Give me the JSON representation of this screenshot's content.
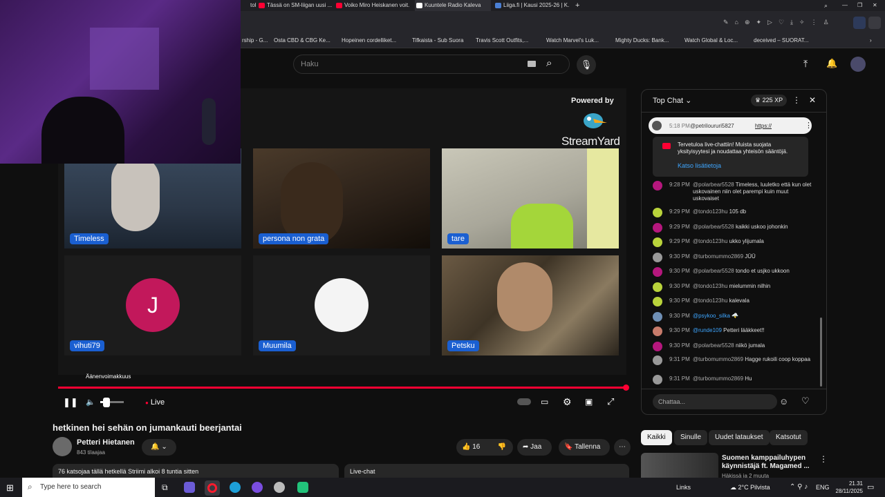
{
  "browser": {
    "tabs": [
      {
        "label": "Tässä on SM-liigan uusi ..."
      },
      {
        "label": "Voiko Miro Heiskanen voit..."
      },
      {
        "label": "Kuuntele Radio Kaleva"
      },
      {
        "label": "Liiga.fi | Kausi 2025-26 | K..."
      }
    ],
    "bookmarks": [
      "rship - G...",
      "Osta CBD & CBG Ke...",
      "Hopeinen cordelliket...",
      "Tifkaista - Sub Suora",
      "Travis Scott Outfits,...",
      "Watch Marvel's Luk...",
      "Mighty Ducks: Bank...",
      "Watch Global & Loc...",
      "deceived – SUORAT..."
    ]
  },
  "youtube": {
    "search_placeholder": "Haku",
    "powered_by": "Powered by",
    "brand": "StreamYard",
    "participants": [
      {
        "name": "Timeless"
      },
      {
        "name": "persona non grata"
      },
      {
        "name": "tare"
      },
      {
        "name": "vihuti79",
        "initial": "J"
      },
      {
        "name": "Muumila"
      },
      {
        "name": "Petsku"
      }
    ],
    "volume_tooltip": "Äänenvoimakkuus",
    "live_label": "Live",
    "video_title": "hetkinen hei sehän on jumankauti beerjantai",
    "channel": {
      "name": "Petteri Hietanen",
      "subs": "843 tilaajaa"
    },
    "likes": "16",
    "share_label": "Jaa",
    "save_label": "Tallenna",
    "viewers_text": "76 katsojaa tällä hetkellä  Striimi alkoi 8 tuntia sitten",
    "livechat_label": "Live-chat",
    "chips": [
      "Kaikki",
      "Sinulle",
      "Uudet lataukset",
      "Katsotut"
    ],
    "recommended": {
      "title": "Suomen kamppailuhypen käynnistäjä ft. Magamed ...",
      "sub": "Häkissä ja 2 muuta"
    }
  },
  "chat": {
    "header": "Top Chat",
    "xp": "225 XP",
    "pinned_author": "@petriloururi5827",
    "pinned_time": "5:18 PM",
    "pinned_text": "https://",
    "welcome": "Tervetuloa live-chattiin! Muista suojata yksityisyytesi ja noudattaa yhteisön sääntöjä.",
    "learn_more": "Katso lisätietoja",
    "input_placeholder": "Chattaa...",
    "messages": [
      {
        "time": "9:28 PM",
        "author": "@polarbear5528",
        "text": "Timeless, luuletko että kun olet uskovainen niin olet parempi kuin muut uskovaiset",
        "color": "#b5177d"
      },
      {
        "time": "9:29 PM",
        "author": "@tondo123hu",
        "text": "105 db",
        "color": "#b9d33b"
      },
      {
        "time": "9:29 PM",
        "author": "@polarbear5528",
        "text": "kaikki uskoo johonkin",
        "color": "#b5177d"
      },
      {
        "time": "9:29 PM",
        "author": "@tondo123hu",
        "text": "ukko ylijumala",
        "color": "#b9d33b"
      },
      {
        "time": "9:30 PM",
        "author": "@turbomummo2869",
        "text": "JÜÜ",
        "color": "#999999"
      },
      {
        "time": "9:30 PM",
        "author": "@polarbear5528",
        "text": "tondo et usjko ukkoon",
        "color": "#b5177d"
      },
      {
        "time": "9:30 PM",
        "author": "@tondo123hu",
        "text": "mielummin nilhin",
        "color": "#b9d33b"
      },
      {
        "time": "9:30 PM",
        "author": "@tondo123hu",
        "text": "kalevala",
        "color": "#b9d33b"
      },
      {
        "time": "9:30 PM",
        "author": "@psykoo_silka",
        "text": "🌩️",
        "color": "#6f8fb5"
      },
      {
        "time": "9:30 PM",
        "author": "@runde109",
        "text": "Petteri lääkkeet!!",
        "color": "#c77b6b"
      },
      {
        "time": "9:30 PM",
        "author": "@polarbear5528",
        "text": "niikö jumala",
        "color": "#b5177d"
      },
      {
        "time": "9:31 PM",
        "author": "@turbomummo2869",
        "text": "Hagge rukoili coop koppaa",
        "color": "#999999"
      },
      {
        "time": "9:31 PM",
        "author": "@turbomummo2869",
        "text": "Hu",
        "color": "#999999"
      }
    ]
  },
  "taskbar": {
    "search_placeholder": "Type here to search",
    "links": "Links",
    "weather": "2°C  Pilvista",
    "lang": "ENG",
    "time": "21.31",
    "date": "28/11/2025"
  },
  "colors": {
    "accent": "#ff0033",
    "nametag": "#1a5fd1",
    "avatar_j": "#c2185b"
  }
}
